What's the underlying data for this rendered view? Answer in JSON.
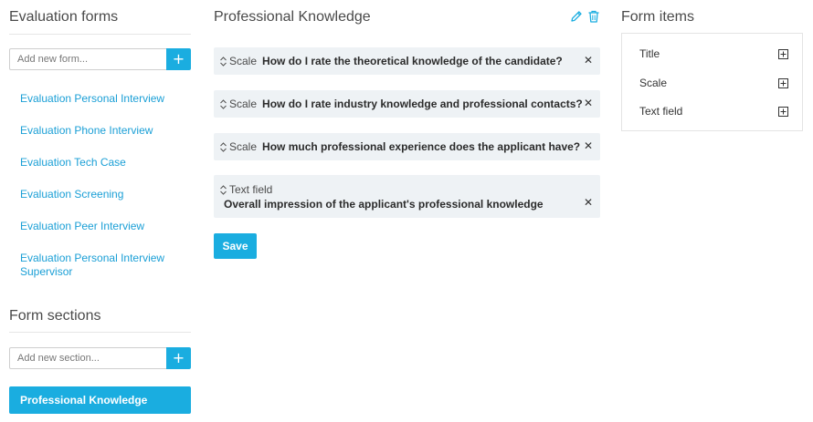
{
  "left": {
    "forms_heading": "Evaluation forms",
    "add_form_placeholder": "Add new form...",
    "add_button_label": "+",
    "forms": [
      "Evaluation Personal Interview",
      "Evaluation Phone Interview",
      "Evaluation Tech Case",
      "Evaluation Screening",
      "Evaluation Peer Interview",
      "Evaluation Personal Interview Supervisor"
    ],
    "sections_heading": "Form sections",
    "add_section_placeholder": "Add new section...",
    "active_section": "Professional Knowledge"
  },
  "main": {
    "title": "Professional Knowledge",
    "items": [
      {
        "type": "Scale",
        "question": "How do I rate the theoretical knowledge of the candidate?"
      },
      {
        "type": "Scale",
        "question": "How do I rate industry knowledge and professional contacts?"
      },
      {
        "type": "Scale",
        "question": "How much professional experience does the applicant have?"
      },
      {
        "type": "Text field",
        "question": "Overall impression of the applicant's professional knowledge"
      }
    ],
    "remove_glyph": "✕",
    "save_label": "Save"
  },
  "right": {
    "heading": "Form items",
    "items": [
      "Title",
      "Scale",
      "Text field"
    ]
  },
  "colors": {
    "accent": "#1aade0",
    "link": "#1a9fd6",
    "item_bg": "#eef2f5"
  },
  "icons": [
    "pencil-icon",
    "trash-icon",
    "sort-icon",
    "close-icon",
    "square-plus-icon"
  ]
}
